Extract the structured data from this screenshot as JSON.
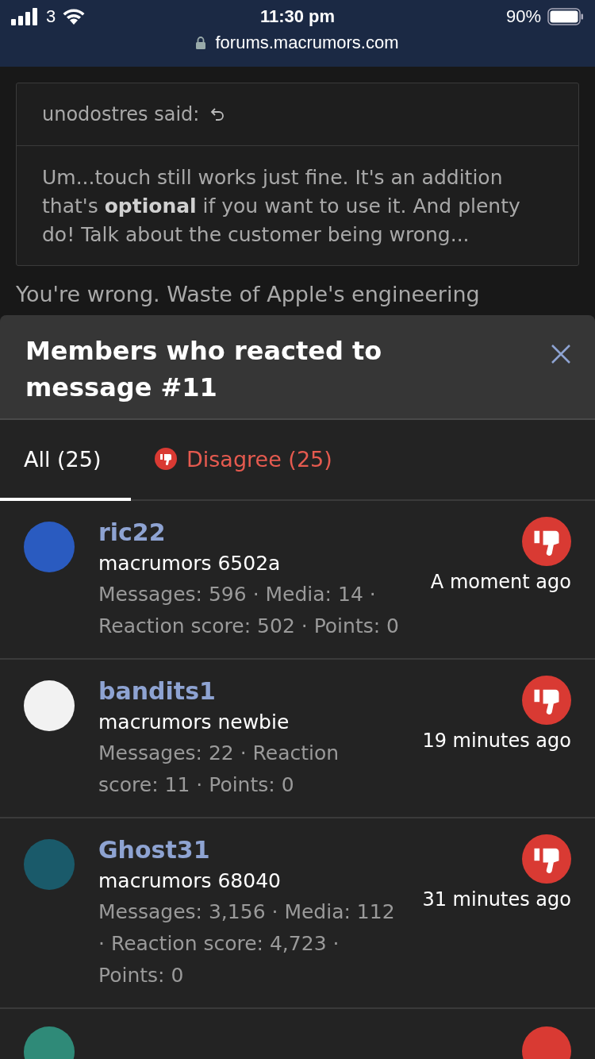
{
  "status_bar": {
    "carrier": "3",
    "time": "11:30 pm",
    "battery": "90%",
    "url": "forums.macrumors.com"
  },
  "quote": {
    "author": "unodostres said:",
    "text": "Um...touch still works just fine. It's an addition that's **optional** if you want to use it. And plenty do! Talk about the customer being wrong..."
  },
  "post_text": "You're wrong. Waste of Apple's engineering",
  "modal": {
    "title": "Members who reacted to message #11",
    "tabs": [
      {
        "label": "All (25)",
        "selected": true,
        "kind": "all"
      },
      {
        "label": "Disagree (25)",
        "selected": false,
        "kind": "disagree"
      }
    ],
    "members": [
      {
        "name": "ric22",
        "rank": "macrumors 6502a",
        "stats": "Messages: 596 · Media: 14 · Reaction score: 502 · Points: 0",
        "time": "A moment ago",
        "color": "#2a5bc0"
      },
      {
        "name": "bandits1",
        "rank": "macrumors newbie",
        "stats": "Messages: 22 · Reaction score: 11 · Points: 0",
        "time": "19 minutes ago",
        "color": "#f2f2f2"
      },
      {
        "name": "Ghost31",
        "rank": "macrumors 68040",
        "stats": "Messages: 3,156 · Media: 112 · Reaction score: 4,723 · Points: 0",
        "time": "31 minutes ago",
        "color": "#1a5a6a"
      }
    ]
  }
}
